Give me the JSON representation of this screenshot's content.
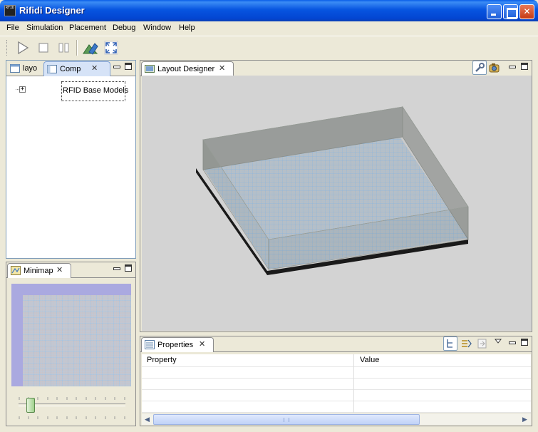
{
  "window": {
    "title": "Rifidi Designer",
    "icon_label": "RFID",
    "controls": [
      "minimize",
      "maximize",
      "close"
    ]
  },
  "menu": {
    "items": [
      {
        "label": "File"
      },
      {
        "label": "Simulation"
      },
      {
        "label": "Placement"
      },
      {
        "label": "Debug"
      },
      {
        "label": "Window"
      },
      {
        "label": "Help"
      }
    ]
  },
  "toolbar": {
    "buttons": [
      "play-icon",
      "stop-icon",
      "pause-icon",
      "place-icon",
      "fullscreen-icon"
    ]
  },
  "components_panel": {
    "tabs": [
      {
        "label": "layo"
      },
      {
        "label": "Comp",
        "close": "✕"
      }
    ],
    "tree": {
      "expander": "+",
      "node_label": "RFID Base Models"
    }
  },
  "minimap_panel": {
    "tab": {
      "label": "Minimap",
      "close": "✕"
    },
    "zoom_level": 0.1
  },
  "layout_panel": {
    "tab": {
      "label": "Layout Designer",
      "close": "✕"
    },
    "tools": [
      "wrench-icon",
      "camera-icon"
    ]
  },
  "properties_panel": {
    "tab": {
      "label": "Properties",
      "close": "✕"
    },
    "columns": [
      "Property",
      "Value"
    ],
    "rows": [],
    "tools": [
      "tree-icon",
      "advanced-icon",
      "defaults-icon",
      "menu-icon"
    ],
    "scroll": {
      "left_arrow": "◀",
      "right_arrow": "▶"
    }
  },
  "colors": {
    "titlebar": "#0755e0",
    "viewport_bg": "#d3d3d3",
    "floor_blue": "#a9c4e4",
    "minimap_bg": "#aaa9e0"
  }
}
